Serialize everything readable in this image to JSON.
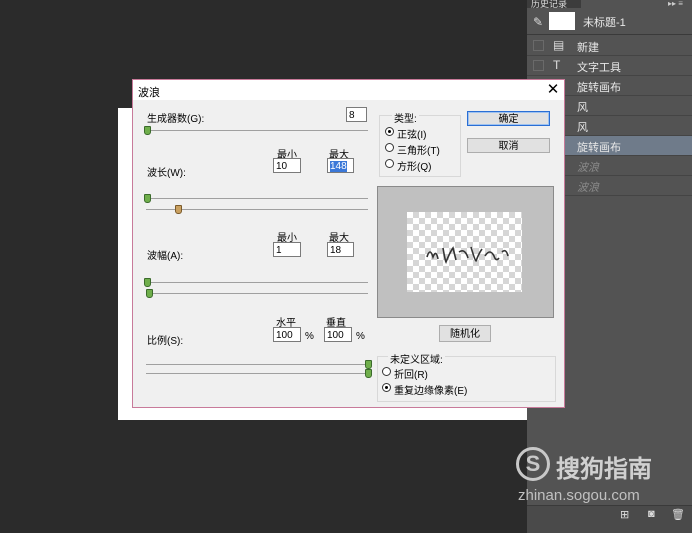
{
  "history": {
    "tab_label": "历史记录",
    "menu_glyph": "▸▸ ≡",
    "snapshot_label": "未标题-1",
    "items": [
      {
        "label": "新建",
        "icon": "document-icon",
        "glyph": "▤"
      },
      {
        "label": "文字工具",
        "icon": "type-icon",
        "glyph": "T"
      },
      {
        "label": "旋转画布",
        "icon": "rotate-icon",
        "glyph": "↻"
      },
      {
        "label": "风",
        "icon": "filter-icon",
        "glyph": "▦"
      },
      {
        "label": "风",
        "icon": "filter-icon",
        "glyph": "▦"
      },
      {
        "label": "旋转画布",
        "icon": "rotate-icon",
        "glyph": "↻"
      },
      {
        "label": "波浪",
        "icon": "filter-icon",
        "glyph": "▦"
      },
      {
        "label": "波浪",
        "icon": "filter-icon",
        "glyph": "▦"
      }
    ],
    "footer": {
      "new_doc_glyph": "⊞",
      "camera_glyph": "◙",
      "trash_glyph": "🗑"
    }
  },
  "dialog": {
    "title": "波浪",
    "close_glyph": "✕",
    "generators_label": "生成器数(G):",
    "generators_value": "8",
    "wavelength_label": "波长(W):",
    "amplitude_label": "波幅(A):",
    "scale_label": "比例(S):",
    "min_label": "最小",
    "max_label": "最大",
    "wavelength_min": "10",
    "wavelength_max": "148",
    "amplitude_min": "1",
    "amplitude_max": "18",
    "horizontal_label": "水平",
    "vertical_label": "垂直",
    "scale_h": "100",
    "scale_v": "100",
    "percent": "%",
    "type_label": "类型:",
    "types": [
      "正弦(I)",
      "三角形(T)",
      "方形(Q)"
    ],
    "ok_label": "确定",
    "cancel_label": "取消",
    "randomize_label": "随机化",
    "undefined_label": "未定义区域:",
    "undefined_options": [
      "折回(R)",
      "重复边缘像素(E)"
    ],
    "preview_text": "wind text"
  },
  "watermark": {
    "logo_glyph": "S",
    "name": "搜狗指南",
    "url": "zhinan.sogou.com"
  }
}
